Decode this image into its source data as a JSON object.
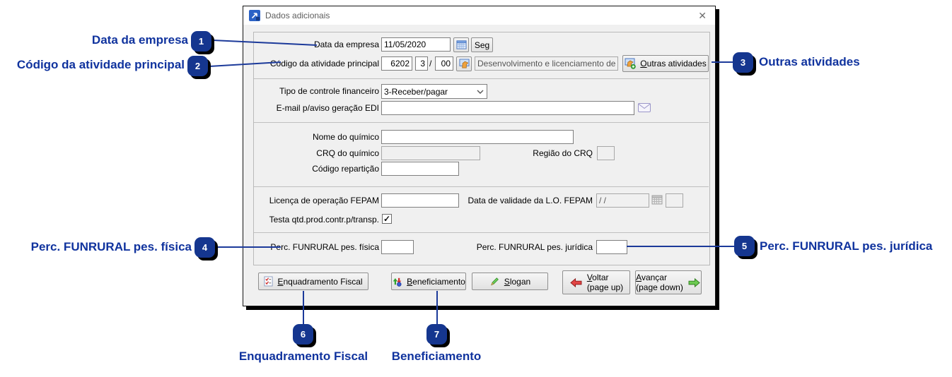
{
  "window": {
    "title": "Dados adicionais",
    "close_glyph": "✕"
  },
  "form": {
    "data_empresa": {
      "label": "Data da empresa",
      "value": "11/05/2020",
      "weekday_btn": "Seg"
    },
    "atividade": {
      "label": "Código da atividade principal",
      "code": "6202",
      "digit": "3",
      "sep": "/",
      "suffix": "00",
      "descricao": "Desenvolvimento e licenciamento de",
      "outras": {
        "u": "O",
        "rest": "utras atividades"
      }
    },
    "controle": {
      "label": "Tipo de controle financeiro",
      "value": "3-Receber/pagar"
    },
    "email_edi": {
      "label": "E-mail p/aviso geração EDI",
      "value": ""
    },
    "quimico": {
      "nome_label": "Nome do químico",
      "nome_value": "",
      "crq_label": "CRQ do químico",
      "crq_value": "",
      "regiao_label": "Região do CRQ",
      "regiao_value": "",
      "reparticao_label": "Código repartição",
      "reparticao_value": ""
    },
    "fepam": {
      "licenca_label": "Licença de operação FEPAM",
      "licenca_value": "",
      "validade_label": "Data de validade da L.O. FEPAM",
      "validade_value": "/ /",
      "validade_extra": "",
      "testa_label": "Testa qtd.prod.contr.p/transp.",
      "testa_checked": true,
      "check_glyph": "✓"
    },
    "funrural": {
      "fisica_label": "Perc. FUNRURAL pes. física",
      "fisica_value": "",
      "juridica_label": "Perc. FUNRURAL pes. jurídica",
      "juridica_value": ""
    }
  },
  "buttons": {
    "enquadramento": {
      "u": "E",
      "rest": "nquadramento Fiscal"
    },
    "beneficiamento": {
      "u": "B",
      "rest": "eneficiamento"
    },
    "slogan": {
      "u": "S",
      "rest": "logan"
    },
    "voltar": {
      "u": "V",
      "rest": "oltar",
      "sub": "(page up)"
    },
    "avancar": {
      "u": "A",
      "rest": "vançar",
      "sub": "(page down)"
    }
  },
  "annotations": [
    {
      "num": "1",
      "label": "Data da empresa"
    },
    {
      "num": "2",
      "label": "Código da atividade principal"
    },
    {
      "num": "3",
      "label": "Outras atividades"
    },
    {
      "num": "4",
      "label": "Perc. FUNRURAL pes. física"
    },
    {
      "num": "5",
      "label": "Perc. FUNRURAL pes. jurídica"
    },
    {
      "num": "6",
      "label": "Enquadramento Fiscal"
    },
    {
      "num": "7",
      "label": "Beneficiamento"
    }
  ],
  "colors": {
    "annotation_ink": "#10339e",
    "badge_fill": "#15368f",
    "dialog_bg": "#f0f0f0"
  }
}
